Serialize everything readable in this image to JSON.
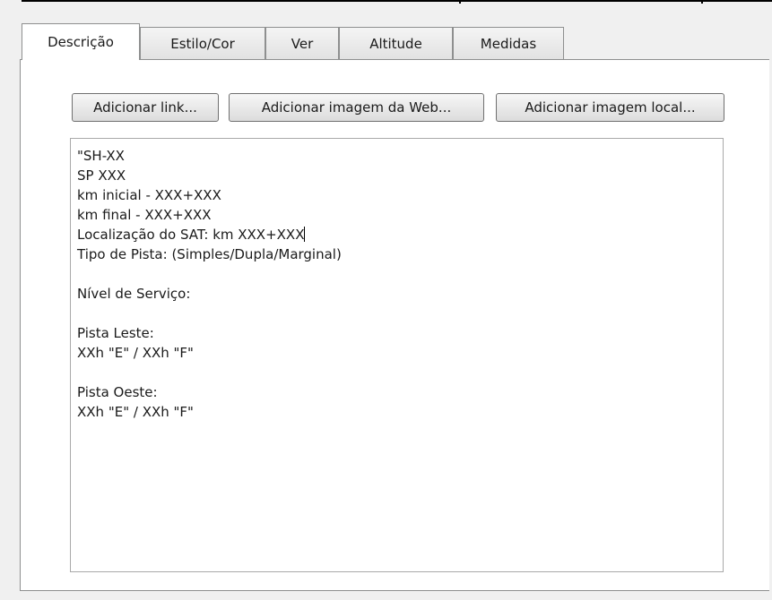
{
  "tabs": [
    {
      "label": "Descrição",
      "active": true
    },
    {
      "label": "Estilo/Cor",
      "active": false
    },
    {
      "label": "Ver",
      "active": false
    },
    {
      "label": "Altitude",
      "active": false
    },
    {
      "label": "Medidas",
      "active": false
    }
  ],
  "buttons": {
    "add_link": "Adicionar link...",
    "add_web_image": "Adicionar imagem da Web...",
    "add_local_image": "Adicionar imagem local..."
  },
  "description_lines": [
    "\"SH-XX",
    "SP XXX",
    "km inicial - XXX+XXX",
    "km final - XXX+XXX",
    "Localização do SAT: km XXX+XXX",
    "Tipo de Pista: (Simples/Dupla/Marginal)",
    "",
    "Nível de Serviço:",
    "",
    "Pista Leste:",
    "XXh \"E\" / XXh \"F\"",
    "",
    "Pista Oeste:",
    "XXh \"E\" / XXh \"F\""
  ]
}
